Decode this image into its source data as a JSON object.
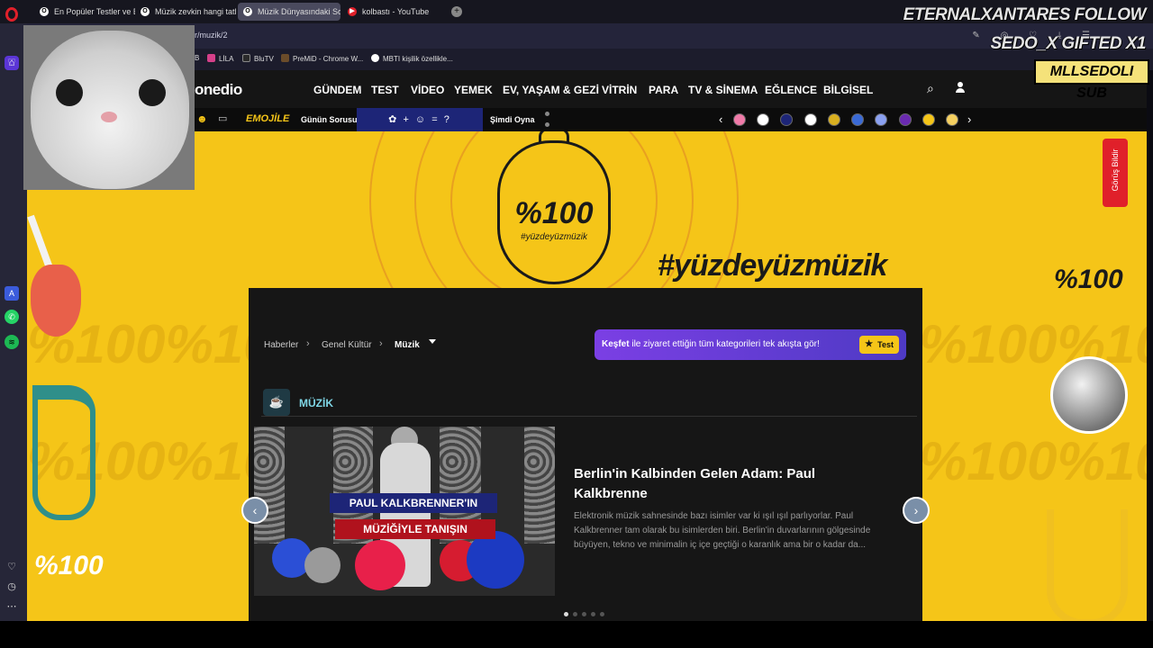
{
  "browser": {
    "tabs": [
      {
        "title": "En Popüler Testler ve Eğle",
        "favicon": "O",
        "active": false
      },
      {
        "title": "Müzik zevkin hangi tatlı?",
        "favicon": "O",
        "active": false
      },
      {
        "title": "Müzik Dünyasındaki Son",
        "favicon": "O",
        "active": true
      },
      {
        "title": "kolbastı - YouTube",
        "favicon": "▶",
        "active": false
      }
    ],
    "new_tab": "+",
    "url": "r/muzik/2",
    "bookmarks": [
      "B",
      "LİLA",
      "BluTV",
      "PreMiD - Chrome W...",
      "MBTI kişilik özellikle..."
    ]
  },
  "site": {
    "logo": "onedio",
    "nav": [
      "GÜNDEM",
      "TEST",
      "VİDEO",
      "YEMEK",
      "EV, YAŞAM & GEZİ",
      "VİTRİN",
      "PARA",
      "TV & SİNEMA",
      "EĞLENCE",
      "BİLGİSEL"
    ],
    "emojile": "EMOJİLE",
    "gunun_sorusu": "Günün Sorusu",
    "puzzle": "✿ + ☺ = ?",
    "simdi_oyna": "Şimdi Oyna",
    "story_colors": [
      "#f07aa8",
      "#ffffff",
      "#1d2577",
      "#ffffff",
      "#d9b020",
      "#3a6ad6",
      "#8aa0f0",
      "#6a2ab0",
      "#f5c518",
      "#f5d060"
    ]
  },
  "hero": {
    "badge_big": "%100",
    "badge_small": "#yüzdeyüzmüzik",
    "hashtag": "#yüzdeyüzmüzik",
    "logo_right": "%100",
    "logo_left": "%100",
    "feedback": "Görüş Bildir"
  },
  "card": {
    "breadcrumb": [
      "Haberler",
      "Genel Kültür",
      "Müzik"
    ],
    "kesfet_bold": "Keşfet",
    "kesfet_text": " ile ziyaret ettiğin tüm kategorileri tek akışta gör!",
    "kesfet_button": "Test",
    "section_title": "MÜZİK",
    "slide_banner_1": "PAUL KALKBRENNER'IN",
    "slide_banner_2": "MÜZİĞİYLE TANIŞIN",
    "article_title": "Berlin'in Kalbinden Gelen Adam: Paul Kalkbrenne",
    "article_desc": "Elektronik müzik sahnesinde bazı isimler var ki ışıl ışıl parlıyorlar. Paul Kalkbrenner tam olarak bu isimlerden biri. Berlin'in duvarlarının gölgesinde büyüyen, tekno ve minimalin iç içe geçtiği o karanlık ama bir o kadar da...",
    "slide_count": 5,
    "active_slide": 1
  },
  "overlay": {
    "line1": "ETERNALXANTARES  FOLLOW",
    "line2": "SEDO_X  GIFTED X1",
    "line3": "MLLSEDOLI  SUB"
  },
  "colors": {
    "accent": "#f5c518",
    "brand_dark": "#151515",
    "purple": "#7b3fe4"
  }
}
